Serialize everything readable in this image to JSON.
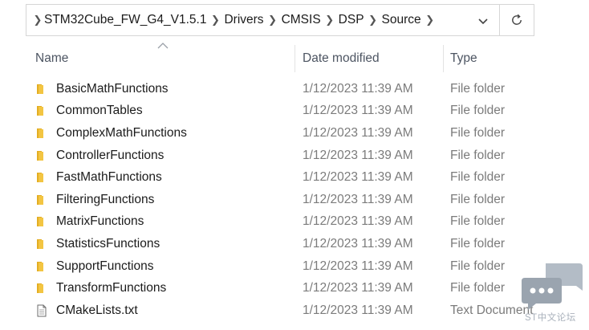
{
  "address_bar": {
    "breadcrumbs": [
      "STM32Cube_FW_G4_V1.5.1",
      "Drivers",
      "CMSIS",
      "DSP",
      "Source"
    ],
    "dropdown_icon": "chevron-down-icon",
    "refresh_icon": "refresh-icon"
  },
  "columns": {
    "name": "Name",
    "date": "Date modified",
    "type": "Type"
  },
  "files": [
    {
      "name": "BasicMathFunctions",
      "date": "1/12/2023 11:39 AM",
      "type": "File folder",
      "icon": "folder-icon"
    },
    {
      "name": "CommonTables",
      "date": "1/12/2023 11:39 AM",
      "type": "File folder",
      "icon": "folder-icon"
    },
    {
      "name": "ComplexMathFunctions",
      "date": "1/12/2023 11:39 AM",
      "type": "File folder",
      "icon": "folder-icon"
    },
    {
      "name": "ControllerFunctions",
      "date": "1/12/2023 11:39 AM",
      "type": "File folder",
      "icon": "folder-icon"
    },
    {
      "name": "FastMathFunctions",
      "date": "1/12/2023 11:39 AM",
      "type": "File folder",
      "icon": "folder-icon"
    },
    {
      "name": "FilteringFunctions",
      "date": "1/12/2023 11:39 AM",
      "type": "File folder",
      "icon": "folder-icon"
    },
    {
      "name": "MatrixFunctions",
      "date": "1/12/2023 11:39 AM",
      "type": "File folder",
      "icon": "folder-icon"
    },
    {
      "name": "StatisticsFunctions",
      "date": "1/12/2023 11:39 AM",
      "type": "File folder",
      "icon": "folder-icon"
    },
    {
      "name": "SupportFunctions",
      "date": "1/12/2023 11:39 AM",
      "type": "File folder",
      "icon": "folder-icon"
    },
    {
      "name": "TransformFunctions",
      "date": "1/12/2023 11:39 AM",
      "type": "File folder",
      "icon": "folder-icon"
    },
    {
      "name": "CMakeLists.txt",
      "date": "1/12/2023 11:39 AM",
      "type": "Text Document",
      "icon": "text-file-icon"
    }
  ],
  "watermark": {
    "text": "ST中文论坛"
  },
  "colors": {
    "folder": "#f3c542",
    "folder_dark": "#e3ae24",
    "muted_text": "#7b7b7b",
    "header_text": "#4d5562",
    "border": "#d6d6d6",
    "watermark": "#b3bcc6"
  }
}
